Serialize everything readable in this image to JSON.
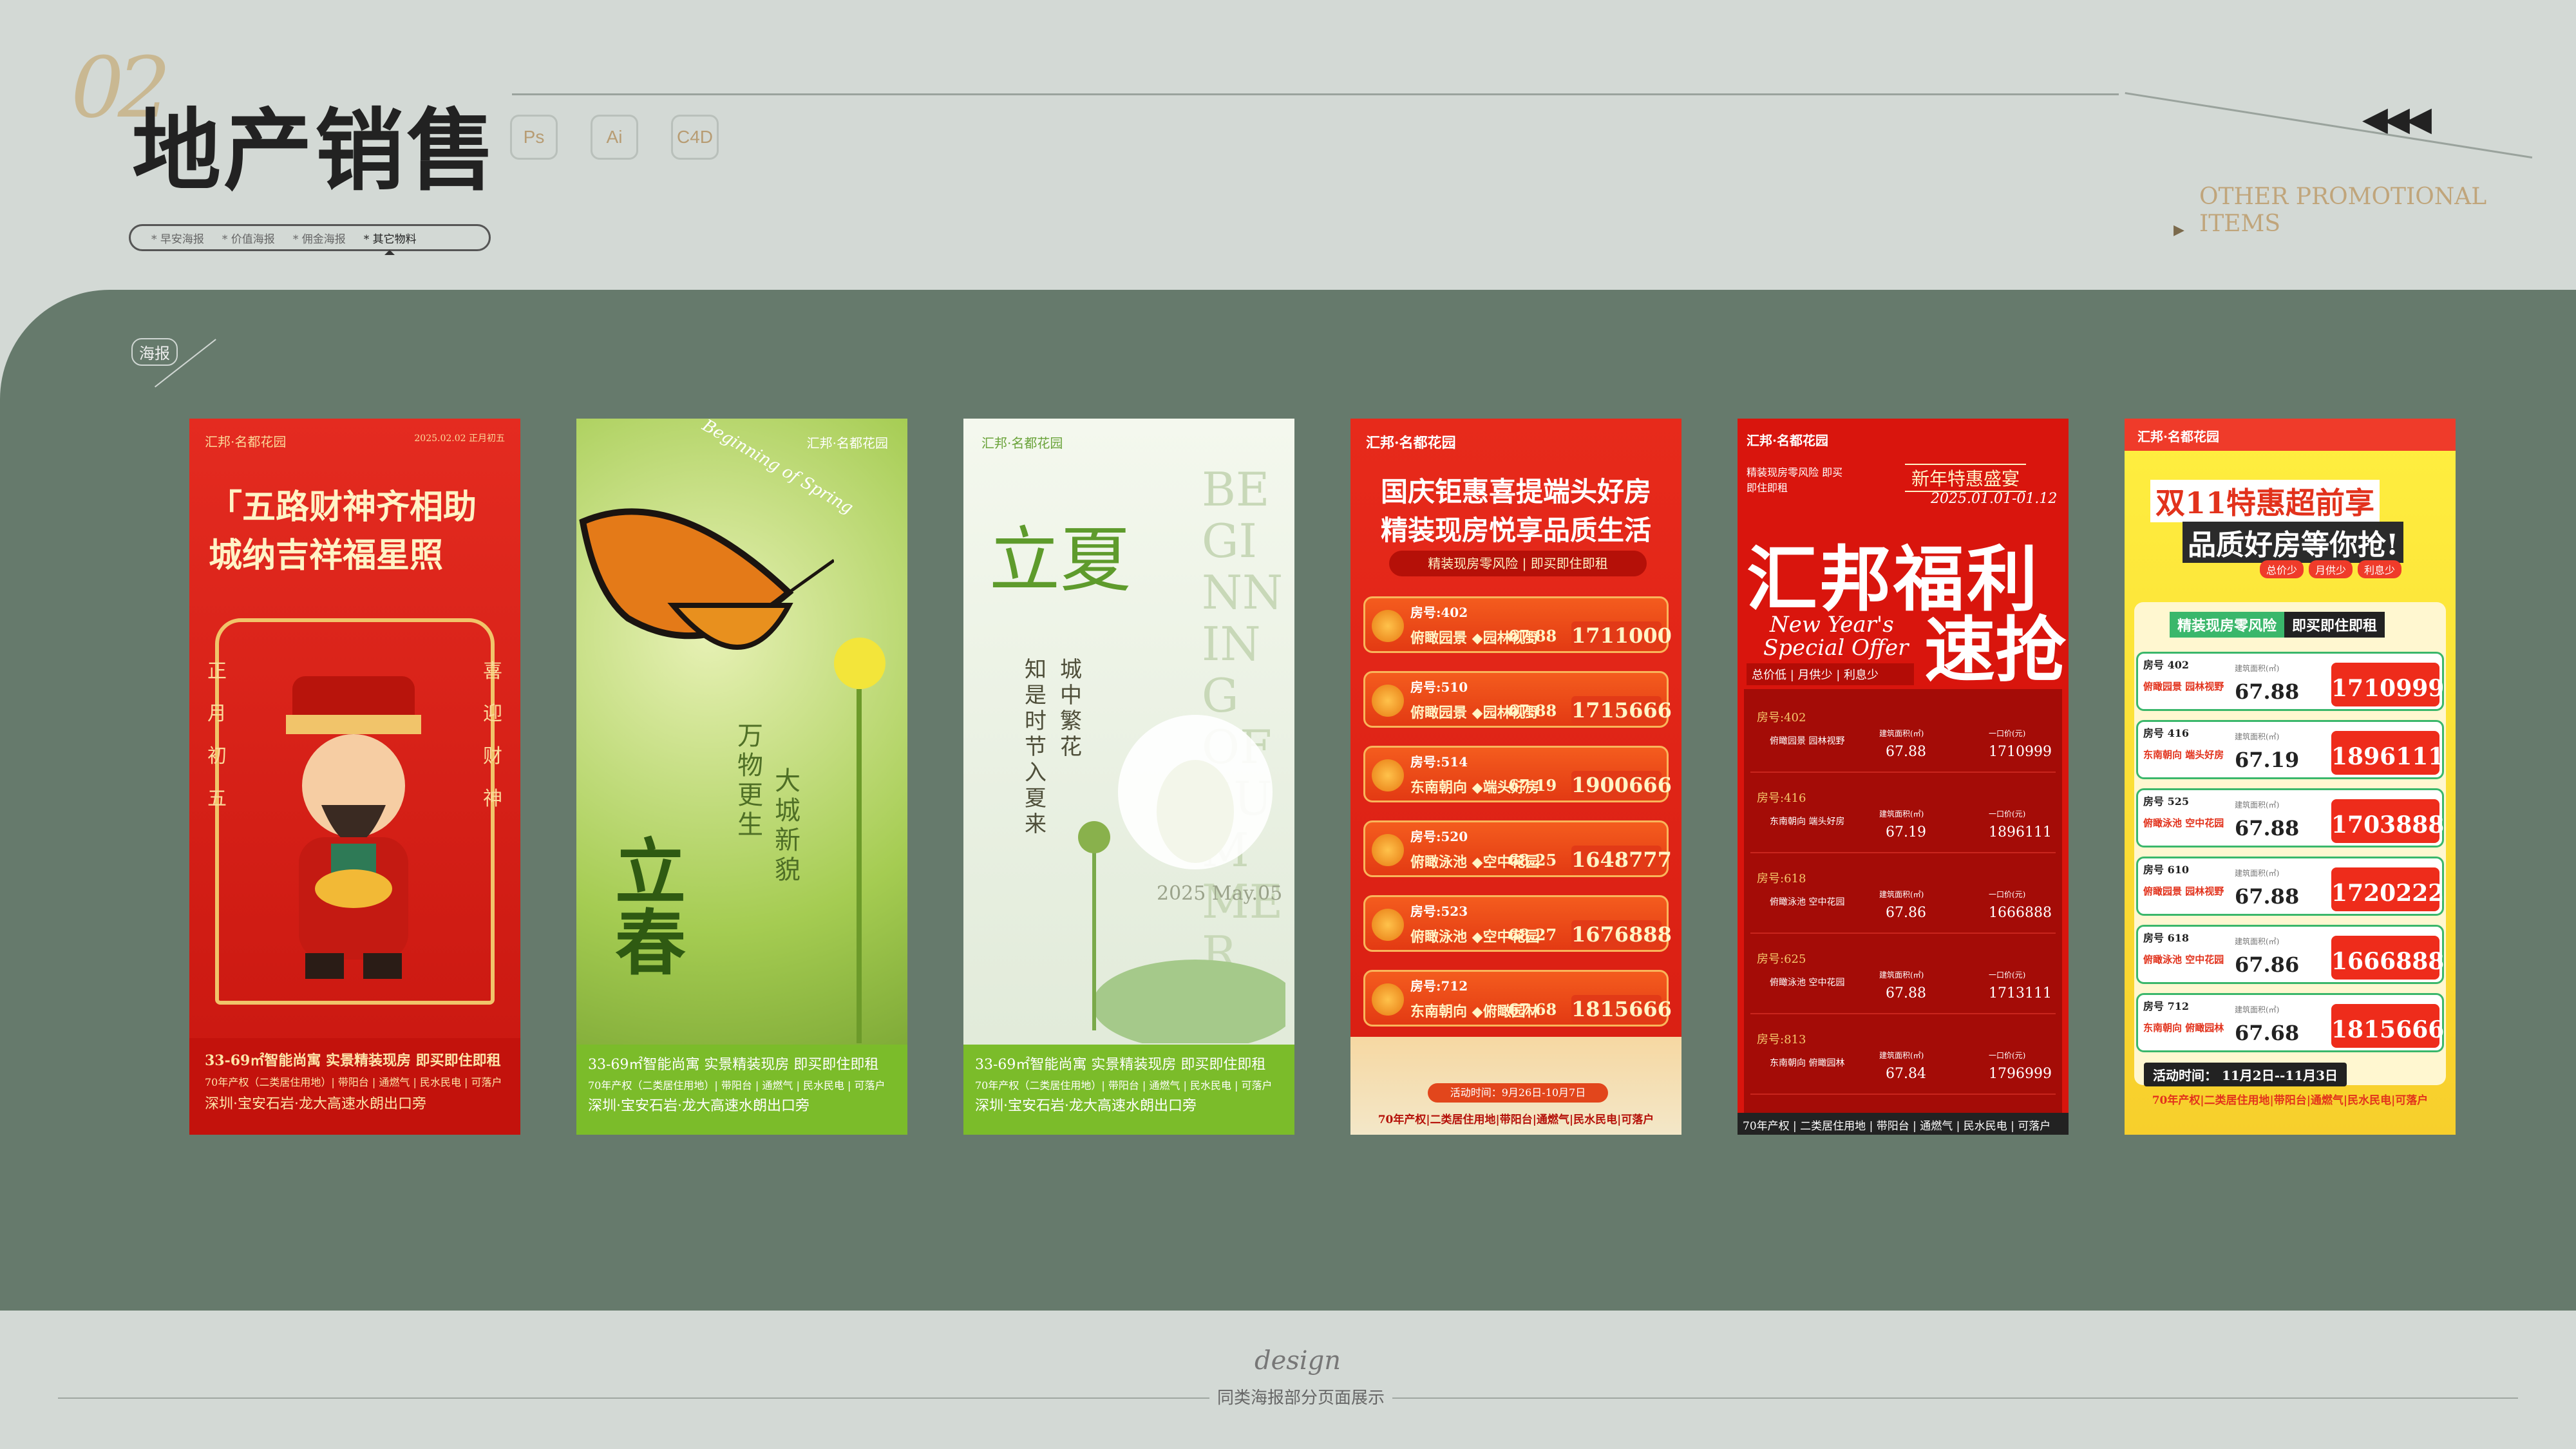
{
  "header": {
    "number": "02",
    "title": "地产销售",
    "tools": [
      "Ps",
      "Ai",
      "C4D"
    ],
    "subnav": [
      "* 早安海报",
      "* 价值海报",
      "* 佣金海报",
      "* 其它物料"
    ],
    "right_label": [
      "OTHER PROMOTIONAL",
      "ITEMS"
    ],
    "arrows": "◀◀◀"
  },
  "section": {
    "tag": "海报"
  },
  "posters": {
    "p1": {
      "brand": "汇邦·名都花园",
      "date": "2025.02.02 正月初五",
      "line1": "「五路财神齐相助",
      "line2": "城纳吉祥福星照",
      "left": [
        "正",
        "月",
        "初",
        "五"
      ],
      "right": [
        "喜",
        "迎",
        "财",
        "神"
      ],
      "foot": [
        "33-69㎡智能尚寓 实景精装现房 即买即住即租",
        "70年产权（二类居住用地）| 带阳台 | 通燃气 | 民水民电 | 可落户",
        "深圳·宝安石岩·龙大高速水朗出口旁"
      ]
    },
    "p2": {
      "brand": "汇邦·名都花园",
      "script": "Beginning of Spring",
      "v1": "大城新貌",
      "v2": "万物更生",
      "big": "立春",
      "foot": [
        "33-69㎡智能尚寓 实景精装现房 即买即住即租",
        "70年产权（二类居住用地）| 带阳台 | 通燃气 | 民水民电 | 可落户",
        "深圳·宝安石岩·龙大高速水朗出口旁"
      ]
    },
    "p3": {
      "brand": "汇邦·名都花园",
      "big": "立夏",
      "eng": "BEGINNING OF SUMMER",
      "v1": "城中繁花",
      "v2": "知是时节入夏来",
      "date": "2025 May.05",
      "foot": [
        "33-69㎡智能尚寓 实景精装现房 即买即住即租",
        "70年产权（二类居住用地）| 带阳台 | 通燃气 | 民水民电 | 可落户",
        "深圳·宝安石岩·龙大高速水朗出口旁"
      ]
    },
    "p4": {
      "brand": "汇邦·名都花园",
      "h1": "国庆钜惠喜提端头好房",
      "h2": "精装现房悦享品质生活",
      "tag": "精装现房零风险 | 即买即住即租",
      "rows": [
        {
          "room": "房号:402",
          "name": "俯瞰园景 ◆园林视野",
          "area": "67.88",
          "price": "1711000"
        },
        {
          "room": "房号:510",
          "name": "俯瞰园景 ◆园林视野",
          "area": "67.88",
          "price": "1715666"
        },
        {
          "room": "房号:514",
          "name": "东南朝向 ◆端头好房",
          "area": "67.19",
          "price": "1900666"
        },
        {
          "room": "房号:520",
          "name": "俯瞰泳池 ◆空中花园",
          "area": "68.25",
          "price": "1648777"
        },
        {
          "room": "房号:523",
          "name": "俯瞰泳池 ◆空中花园",
          "area": "68.27",
          "price": "1676888"
        },
        {
          "room": "房号:712",
          "name": "东南朝向 ◆俯瞰园林",
          "area": "67.68",
          "price": "1815666"
        }
      ],
      "event": "活动时间：9月26日-10月7日",
      "foot": "70年产权|二类居住用地|带阳台|通燃气|民水民电|可落户"
    },
    "p5": {
      "brand": "汇邦·名都花园",
      "note": "精装现房零风险 即买即住即租",
      "tag": "新年特惠盛宴",
      "date": "2025.01.01-01.12",
      "h1": "汇邦福利",
      "h2": "速抢",
      "eng1": "New Year's",
      "eng2": "Special Offer",
      "sub": "总价低 | 月供少 | 利息少",
      "rows": [
        {
          "room": "房号:402",
          "name": "俯瞰园景 园林视野",
          "area": "67.88",
          "price": "1710999"
        },
        {
          "room": "房号:416",
          "name": "东南朝向 端头好房",
          "area": "67.19",
          "price": "1896111"
        },
        {
          "room": "房号:618",
          "name": "俯瞰泳池 空中花园",
          "area": "67.86",
          "price": "1666888"
        },
        {
          "room": "房号:625",
          "name": "俯瞰泳池 空中花园",
          "area": "67.88",
          "price": "1713111"
        },
        {
          "room": "房号:813",
          "name": "东南朝向 俯瞰园林",
          "area": "67.84",
          "price": "1796999"
        }
      ],
      "area_label": "建筑面积(㎡)",
      "price_label": "一口价(元)",
      "foot": "70年产权 | 二类居住用地 | 带阳台 | 通燃气 | 民水民电 | 可落户"
    },
    "p6": {
      "brand": "汇邦·名都花园",
      "h1": "双11特惠超前享",
      "h2": "品质好房等你抢!",
      "chips": [
        "总价少",
        "月供少",
        "利息少"
      ],
      "tag1": "精装现房零风险",
      "tag2": "即买即住即租",
      "rows": [
        {
          "room": "房号 402",
          "name": "俯瞰园景 园林视野",
          "area": "67.88",
          "price": "1710999"
        },
        {
          "room": "房号 416",
          "name": "东南朝向 端头好房",
          "area": "67.19",
          "price": "1896111"
        },
        {
          "room": "房号 525",
          "name": "俯瞰泳池 空中花园",
          "area": "67.88",
          "price": "1703888"
        },
        {
          "room": "房号 610",
          "name": "俯瞰园景 园林视野",
          "area": "67.88",
          "price": "1720222"
        },
        {
          "room": "房号 618",
          "name": "俯瞰泳池 空中花园",
          "area": "67.86",
          "price": "1666888"
        },
        {
          "room": "房号 712",
          "name": "东南朝向 俯瞰园林",
          "area": "67.68",
          "price": "1815666"
        }
      ],
      "area_label": "建筑面积(㎡)",
      "price_label": "一口价(元)",
      "event": "活动时间： 11月2日--11月3日",
      "foot": "70年产权|二类居住用地|带阳台|通燃气|民水民电|可落户"
    }
  },
  "footer": {
    "script": "design",
    "caption": "同类海报部分页面展示"
  }
}
